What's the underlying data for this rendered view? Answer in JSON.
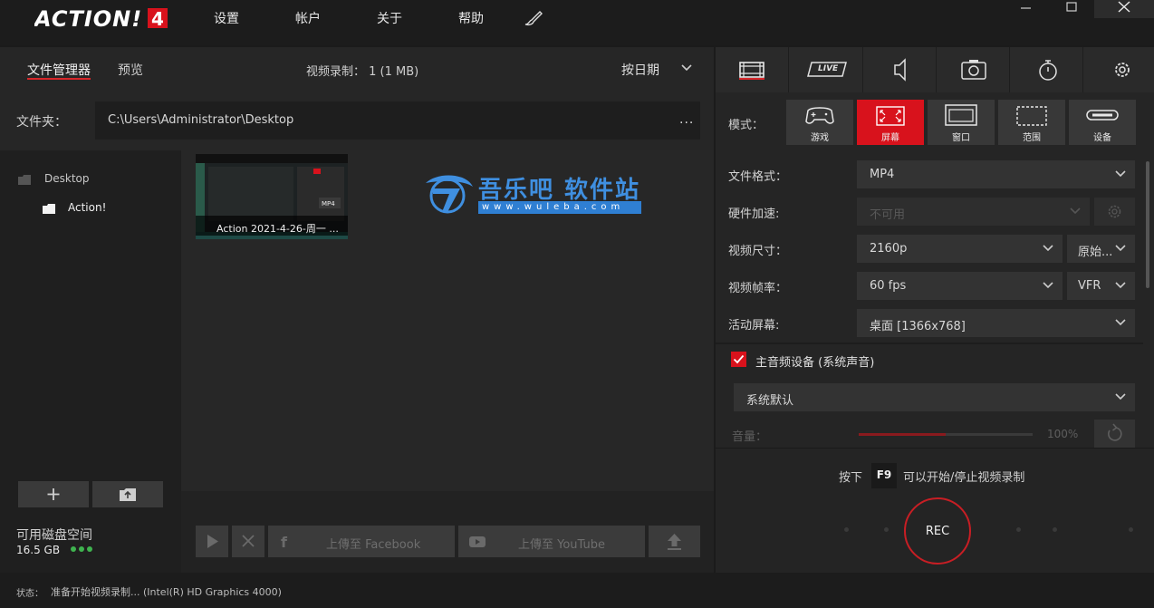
{
  "app": {
    "logo_text": "ACTION!4"
  },
  "menu": {
    "settings": "设置",
    "account": "帐户",
    "about": "关于",
    "help": "帮助"
  },
  "left": {
    "tab_file_manager": "文件管理器",
    "tab_preview": "预览",
    "recording_count": "视频录制： 1 (1 MB)",
    "sort_by": "按日期",
    "folder_label": "文件夹：",
    "folder_path": "C:\\Users\\Administrator\\Desktop",
    "folder_more": "...",
    "tree": {
      "root": "Desktop",
      "child": "Action!"
    },
    "disk_label": "可用磁盘空间",
    "disk_value": "16.5 GB",
    "thumbnail_caption": "Action 2021-4-26-周一 ...",
    "upload_facebook": "上傳至 Facebook",
    "upload_youtube": "上傳至 YouTube"
  },
  "watermark": {
    "text": "吾乐吧 软件站",
    "url": "www.wuleba.com"
  },
  "right": {
    "mode_label": "模式：",
    "modes": [
      {
        "label": "游戏"
      },
      {
        "label": "屏幕"
      },
      {
        "label": "窗口"
      },
      {
        "label": "范围"
      },
      {
        "label": "设备"
      }
    ],
    "active_mode": "屏幕",
    "file_format_label": "文件格式：",
    "file_format_value": "MP4",
    "hw_accel_label": "硬件加速:",
    "hw_accel_value": "不可用",
    "video_size_label": "视频尺寸：",
    "video_size_value": "2160p",
    "video_size_mode": "原始...",
    "fps_label": "视频帧率：",
    "fps_value": "60 fps",
    "fps_mode": "VFR",
    "active_screen_label": "活动屏幕:",
    "active_screen_value": "桌面 [1366x768]",
    "audio_device_label": "主音频设备 (系统声音)",
    "audio_device_value": "系统默认",
    "volume_label": "音量：",
    "volume_percent": "100%",
    "volume_level": 0.5,
    "hint_pre": "按下",
    "hint_key": "F9",
    "hint_post": "可以开始/停止视频录制",
    "rec_label": "REC",
    "live_label": "LIVE"
  },
  "status": {
    "label": "状态：",
    "text": "准备开始视频录制... (Intel(R) HD Graphics 4000)"
  },
  "colors": {
    "accent": "#d8121c",
    "green": "#3fb34f",
    "watermark": "#3f8fe0"
  }
}
